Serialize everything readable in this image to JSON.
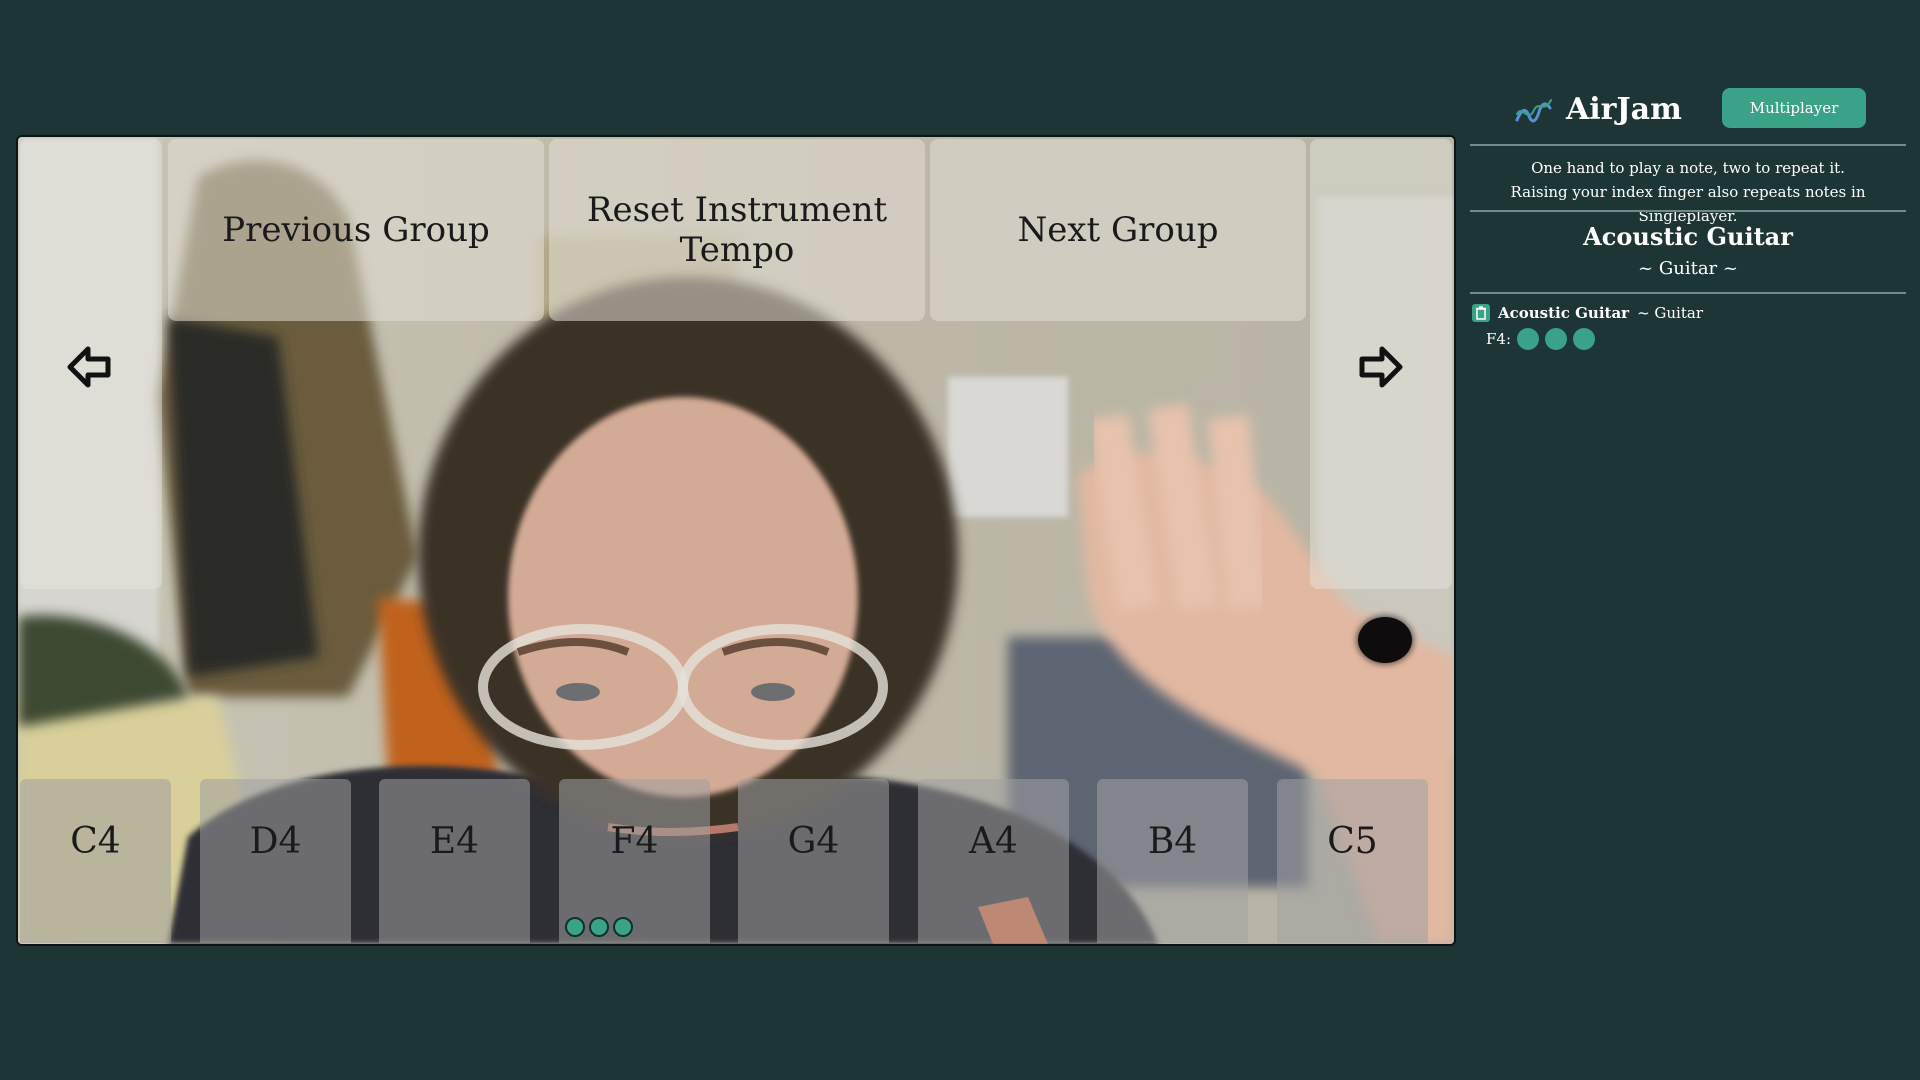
{
  "app": {
    "title": "AirJam",
    "multiplayer_label": "Multiplayer",
    "help_line_1": "One hand to play a note, two to repeat it.",
    "help_line_2": "Raising your index finger also repeats notes in Singleplayer.",
    "accent_color": "#3aa286",
    "background_color": "#1e3535"
  },
  "instrument": {
    "name": "Acoustic Guitar",
    "family": "~ Guitar ~"
  },
  "controls": {
    "previous_group": "Previous Group",
    "reset_tempo": "Reset Instrument Tempo",
    "next_group": "Next Group",
    "left_arrow_icon": "arrow-left-icon",
    "right_arrow_icon": "arrow-right-icon"
  },
  "keys": [
    {
      "note": "C4",
      "repeats": 0
    },
    {
      "note": "D4",
      "repeats": 0
    },
    {
      "note": "E4",
      "repeats": 0
    },
    {
      "note": "F4",
      "repeats": 3
    },
    {
      "note": "G4",
      "repeats": 0
    },
    {
      "note": "A4",
      "repeats": 0
    },
    {
      "note": "B4",
      "repeats": 0
    },
    {
      "note": "C5",
      "repeats": 0
    }
  ],
  "tracks": [
    {
      "name": "Acoustic Guitar",
      "family": "~ Guitar",
      "note_label": "F4:",
      "repeat_count": 3,
      "icon": "trash-icon"
    }
  ]
}
